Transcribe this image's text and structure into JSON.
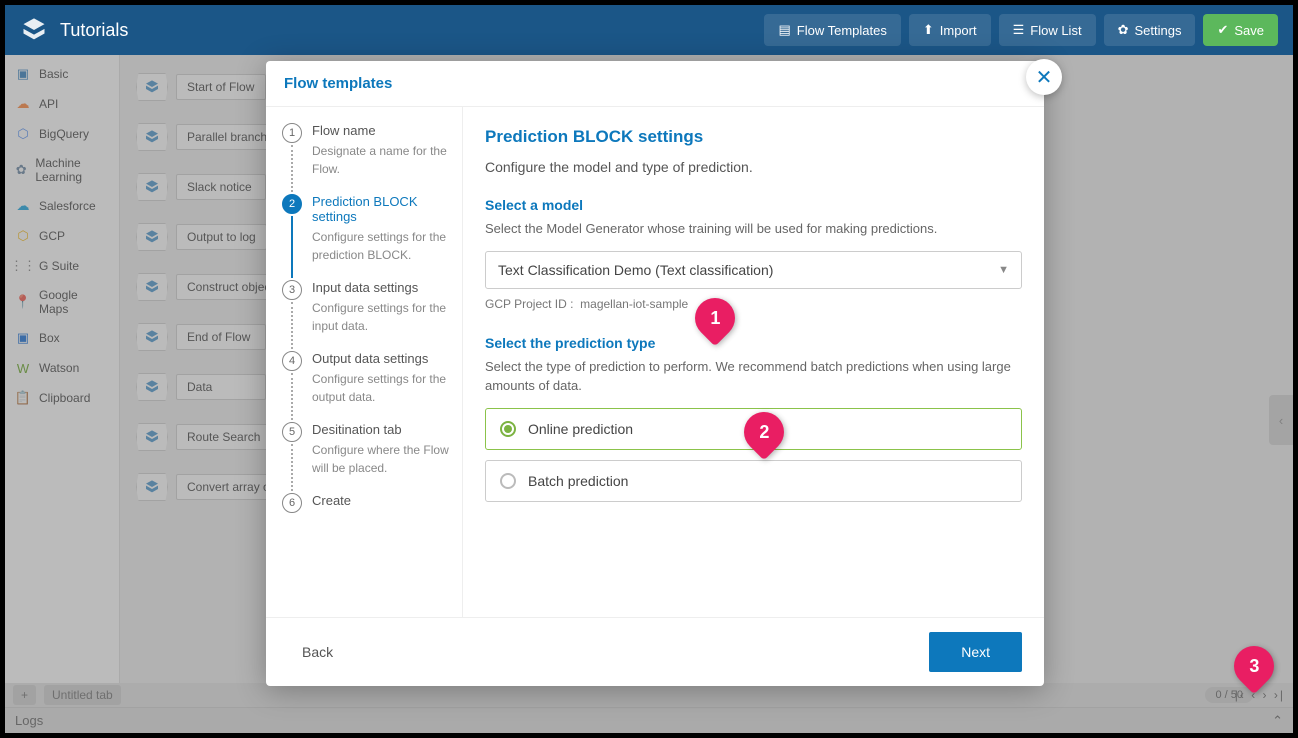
{
  "header": {
    "title": "Tutorials",
    "buttons": {
      "flow_templates": "Flow Templates",
      "import": "Import",
      "flow_list": "Flow List",
      "settings": "Settings",
      "save": "Save"
    }
  },
  "sidebar": {
    "items": [
      {
        "label": "Basic",
        "icon": "box",
        "color": "#1e73b8"
      },
      {
        "label": "API",
        "icon": "cloud",
        "color": "#ff7a29"
      },
      {
        "label": "BigQuery",
        "icon": "hex",
        "color": "#4285f4"
      },
      {
        "label": "Machine Learning",
        "icon": "gear",
        "color": "#5b7b9a"
      },
      {
        "label": "Salesforce",
        "icon": "cloud",
        "color": "#009cde"
      },
      {
        "label": "GCP",
        "icon": "hex",
        "color": "#f4b400"
      },
      {
        "label": "G Suite",
        "icon": "dots",
        "color": "#777"
      },
      {
        "label": "Google Maps",
        "icon": "pin",
        "color": "#ea4335"
      },
      {
        "label": "Box",
        "icon": "box",
        "color": "#0061d5"
      },
      {
        "label": "Watson",
        "icon": "text",
        "color": "#5aa012"
      },
      {
        "label": "Clipboard",
        "icon": "clip",
        "color": "#777"
      }
    ]
  },
  "canvas": {
    "blocks": [
      "Start of Flow",
      "Parallel branch",
      "Slack notice",
      "Output to log",
      "Construct object",
      "End of Flow",
      "Data",
      "Route Search",
      "Convert array of o"
    ]
  },
  "bottom": {
    "tab_label": "Untitled tab",
    "counter": "0 / 50",
    "add": "+"
  },
  "logs": {
    "label": "Logs"
  },
  "modal": {
    "title": "Flow templates",
    "steps": [
      {
        "title": "Flow name",
        "desc": "Designate a name for the Flow."
      },
      {
        "title": "Prediction BLOCK settings",
        "desc": "Configure settings for the prediction BLOCK."
      },
      {
        "title": "Input data settings",
        "desc": "Configure settings for the input data."
      },
      {
        "title": "Output data settings",
        "desc": "Configure settings for the output data."
      },
      {
        "title": "Desitination tab",
        "desc": "Configure where the Flow will be placed."
      },
      {
        "title": "Create",
        "desc": ""
      }
    ],
    "content": {
      "heading": "Prediction BLOCK settings",
      "subtext": "Configure the model and type of prediction.",
      "model_label": "Select a model",
      "model_desc": "Select the Model Generator whose training will be used for making predictions.",
      "model_value": "Text Classification Demo (Text classification)",
      "project_id_label": "GCP Project ID :",
      "project_id_value": "magellan-iot-sample",
      "predtype_label": "Select the prediction type",
      "predtype_desc": "Select the type of prediction to perform. We recommend batch predictions when using large amounts of data.",
      "opt_online": "Online prediction",
      "opt_batch": "Batch prediction"
    },
    "footer": {
      "back": "Back",
      "next": "Next"
    }
  },
  "callouts": {
    "c1": "1",
    "c2": "2",
    "c3": "3"
  }
}
